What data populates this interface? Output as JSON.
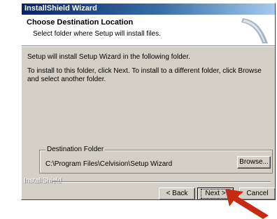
{
  "window": {
    "title": "InstallShield Wizard"
  },
  "header": {
    "title": "Choose Destination Location",
    "subtitle": "Select folder where Setup will install files."
  },
  "body": {
    "line1": "Setup will install Setup Wizard in the following folder.",
    "line2": "To install to this folder, click Next. To install to a different folder, click Browse and select another folder."
  },
  "destination": {
    "group_label": "Destination Folder",
    "path": "C:\\Program Files\\Celvision\\Setup Wizard",
    "browse_label": "Browse..."
  },
  "footer": {
    "brand": "InstallShield",
    "back_label": "< Back",
    "next_label": "Next >",
    "cancel_label": "Cancel"
  },
  "colors": {
    "titlebar_start": "#0a246a",
    "face": "#d4d0c8",
    "arrow": "#c62a12"
  }
}
